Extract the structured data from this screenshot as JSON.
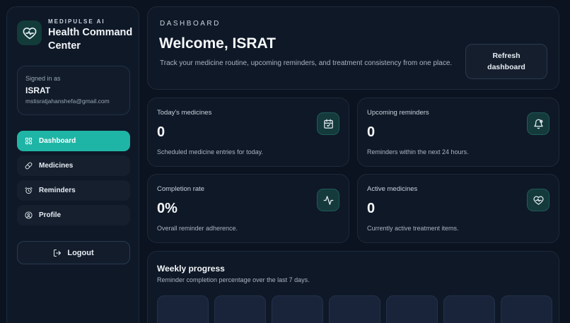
{
  "brand": {
    "kicker": "MEDIPULSE AI",
    "title": "Health Command Center",
    "icon": "heart-pulse-icon"
  },
  "user": {
    "signed_label": "Signed in as",
    "name": "ISRAT",
    "email": "mstisratjahanshefa@gmail.com"
  },
  "nav": {
    "items": [
      {
        "label": "Dashboard",
        "icon": "grid-icon",
        "active": true
      },
      {
        "label": "Medicines",
        "icon": "pill-icon",
        "active": false
      },
      {
        "label": "Reminders",
        "icon": "alarm-icon",
        "active": false
      },
      {
        "label": "Profile",
        "icon": "user-circle-icon",
        "active": false
      }
    ],
    "logout_label": "Logout"
  },
  "hero": {
    "kicker": "DASHBOARD",
    "title": "Welcome, ISRAT",
    "subtitle": "Track your medicine routine, upcoming reminders, and treatment consistency from one place.",
    "refresh_line1": "Refresh",
    "refresh_line2": "dashboard"
  },
  "stats": [
    {
      "label": "Today's medicines",
      "value": "0",
      "desc": "Scheduled medicine entries for today.",
      "icon": "calendar-check-icon"
    },
    {
      "label": "Upcoming reminders",
      "value": "0",
      "desc": "Reminders within the next 24 hours.",
      "icon": "bell-icon"
    },
    {
      "label": "Completion rate",
      "value": "0%",
      "desc": "Overall reminder adherence.",
      "icon": "activity-icon"
    },
    {
      "label": "Active medicines",
      "value": "0",
      "desc": "Currently active treatment items.",
      "icon": "heart-pulse-icon"
    }
  ],
  "weekly": {
    "title": "Weekly progress",
    "subtitle": "Reminder completion percentage over the last 7 days."
  },
  "colors": {
    "accent": "#1fb5a6",
    "background": "#0b1220",
    "panel": "#0f1827",
    "icon_stroke": "#e6edf3"
  }
}
